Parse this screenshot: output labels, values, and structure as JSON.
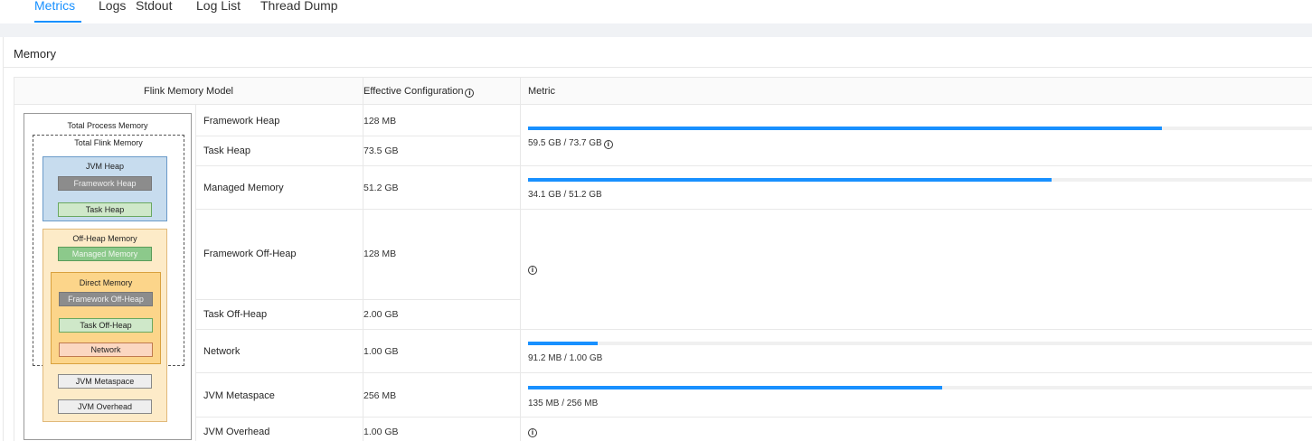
{
  "tabs": [
    {
      "label": "Metrics",
      "active": true
    },
    {
      "label": "Logs"
    },
    {
      "label": "Stdout"
    },
    {
      "label": "Log List"
    },
    {
      "label": "Thread Dump"
    }
  ],
  "section_title": "Memory",
  "table": {
    "headers": {
      "model": "Flink Memory Model",
      "config": "Effective Configuration",
      "metric": "Metric"
    },
    "rows": [
      {
        "name": "Framework Heap",
        "config": "128 MB"
      },
      {
        "name": "Task Heap",
        "config": "73.5 GB"
      },
      {
        "name": "Managed Memory",
        "config": "51.2 GB"
      },
      {
        "name": "Framework Off-Heap",
        "config": "128 MB"
      },
      {
        "name": "Task Off-Heap",
        "config": "2.00 GB"
      },
      {
        "name": "Network",
        "config": "1.00 GB"
      },
      {
        "name": "JVM Metaspace",
        "config": "256 MB"
      },
      {
        "name": "JVM Overhead",
        "config": "1.00 GB"
      }
    ],
    "metrics": {
      "heap": {
        "text": "59.5 GB / 73.7 GB",
        "fraction": 0.807
      },
      "managed": {
        "text": "34.1 GB / 51.2 GB",
        "fraction": 0.666
      },
      "network": {
        "text": "91.2 MB / 1.00 GB",
        "fraction": 0.089
      },
      "metaspace": {
        "text": "135 MB / 256 MB",
        "fraction": 0.527
      }
    }
  },
  "diagram": {
    "total_process": "Total Process Memory",
    "total_flink": "Total Flink Memory",
    "jvm_heap": "JVM Heap",
    "framework_heap": "Framework Heap",
    "task_heap": "Task Heap",
    "off_heap": "Off-Heap Memory",
    "managed": "Managed Memory",
    "direct": "Direct Memory",
    "framework_off_heap": "Framework Off-Heap",
    "task_off_heap": "Task Off-Heap",
    "network": "Network",
    "jvm_metaspace": "JVM Metaspace",
    "jvm_overhead": "JVM Overhead"
  },
  "colors": {
    "accent": "#1890ff",
    "track": "#f0f0f0"
  },
  "icons": {
    "info": "info-circle-icon"
  }
}
